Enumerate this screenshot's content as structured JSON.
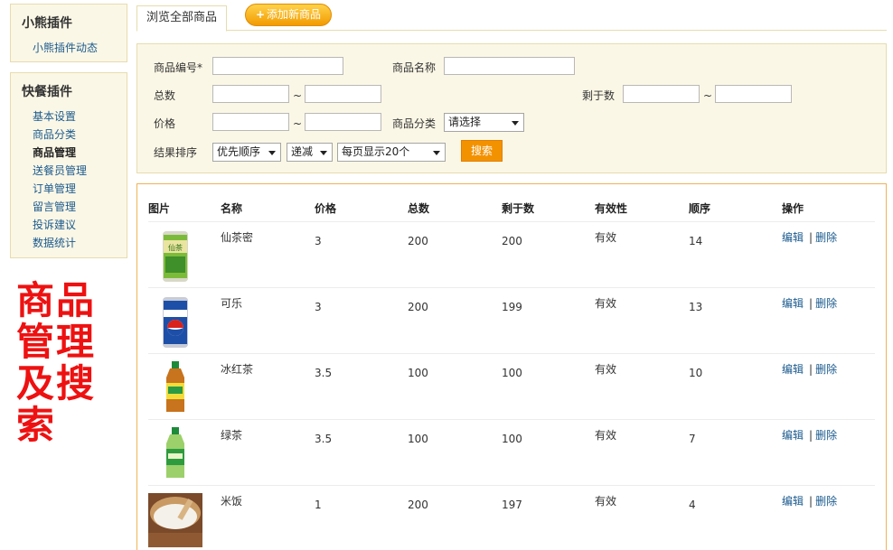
{
  "sidebar": {
    "groups": [
      {
        "title": "小熊插件",
        "items": [
          "小熊插件动态"
        ]
      },
      {
        "title": "快餐插件",
        "items": [
          "基本设置",
          "商品分类",
          "商品管理",
          "送餐员管理",
          "订单管理",
          "留言管理",
          "投诉建议",
          "数据统计"
        ],
        "active": "商品管理"
      }
    ]
  },
  "annotation": [
    "商品",
    "管理",
    "及搜",
    "索"
  ],
  "annotation_color": "#ee1111",
  "tabs": {
    "browse": "浏览全部商品",
    "add": "添加新商品"
  },
  "search": {
    "code_label": "商品编号*",
    "name_label": "商品名称",
    "total_label": "总数",
    "remain_label": "剩于数",
    "price_label": "价格",
    "category_label": "商品分类",
    "category_value": "请选择",
    "sort_label": "结果排序",
    "sort_value": "优先顺序",
    "order_value": "递减",
    "page_value": "每页显示20个",
    "tilde": "~",
    "button": "搜索"
  },
  "table": {
    "headers": [
      "图片",
      "名称",
      "价格",
      "总数",
      "剩于数",
      "有效性",
      "顺序",
      "操作"
    ],
    "rows": [
      {
        "image": "green-tea-can-image",
        "name": "仙茶密",
        "price": "3",
        "total": "200",
        "remain": "200",
        "valid": "有效",
        "order": "14"
      },
      {
        "image": "pepsi-can-image",
        "name": "可乐",
        "price": "3",
        "total": "200",
        "remain": "199",
        "valid": "有效",
        "order": "13"
      },
      {
        "image": "ice-tea-bottle-image",
        "name": "冰红茶",
        "price": "3.5",
        "total": "100",
        "remain": "100",
        "valid": "有效",
        "order": "10"
      },
      {
        "image": "green-tea-bottle-image",
        "name": "绿茶",
        "price": "3.5",
        "total": "100",
        "remain": "100",
        "valid": "有效",
        "order": "7"
      },
      {
        "image": "rice-bucket-image",
        "name": "米饭",
        "price": "1",
        "total": "200",
        "remain": "197",
        "valid": "有效",
        "order": "4"
      }
    ],
    "edit": "编辑",
    "sep": "|",
    "delete": "删除"
  },
  "colors": {
    "panel_bg": "#fbf7e6",
    "panel_border": "#e6dcae",
    "accent_orange": "#f39200",
    "link_blue": "#1a5a8e"
  }
}
